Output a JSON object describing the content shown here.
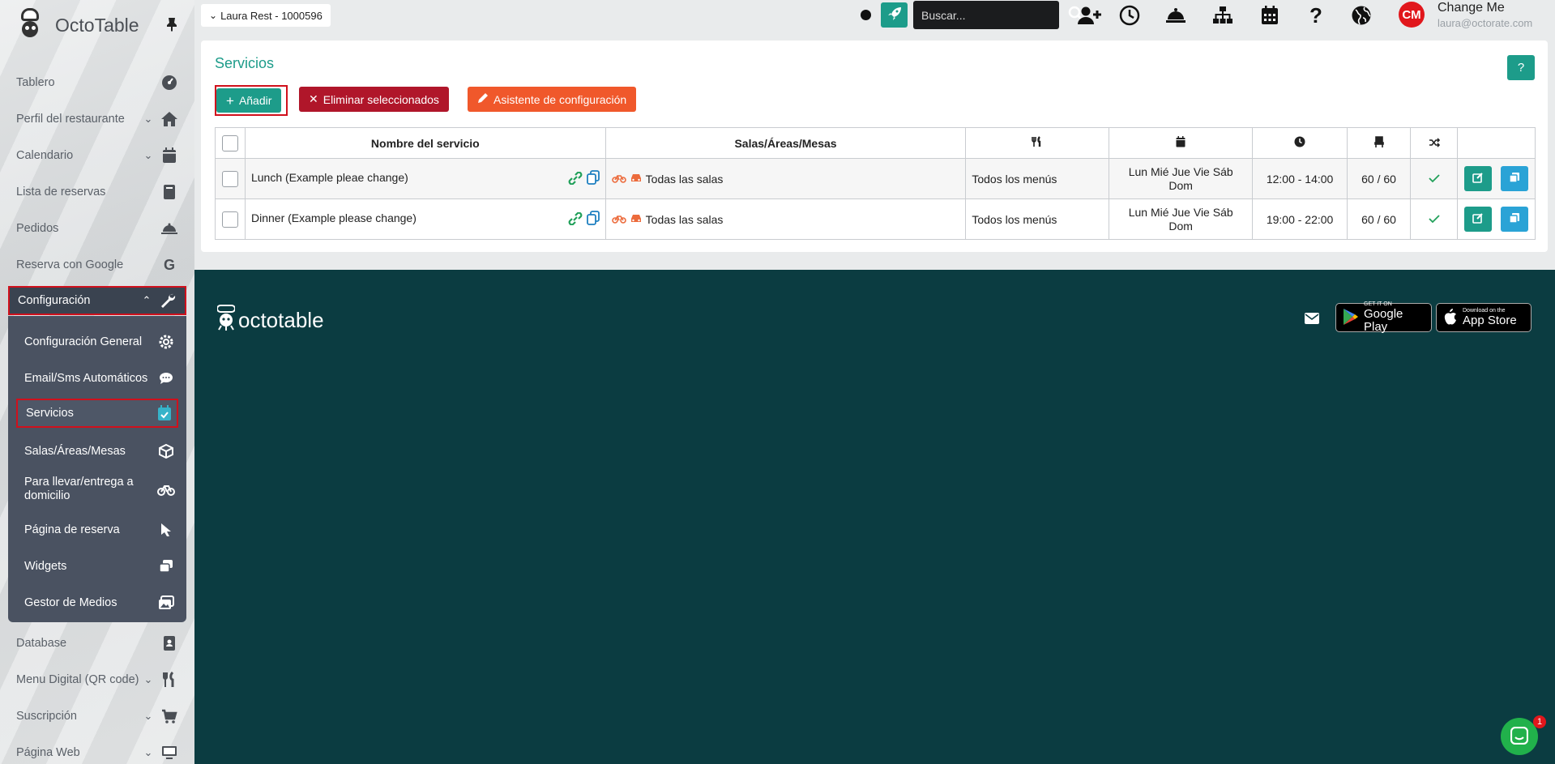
{
  "app": {
    "name": "OctoTable"
  },
  "sidebar": {
    "items": [
      {
        "label": "Tablero",
        "icon": "dashboard-icon"
      },
      {
        "label": "Perfil del restaurante",
        "icon": "home-icon",
        "expandable": true
      },
      {
        "label": "Calendario",
        "icon": "calendar-icon",
        "expandable": true
      },
      {
        "label": "Lista de reservas",
        "icon": "book-icon"
      },
      {
        "label": "Pedidos",
        "icon": "cloche-icon"
      },
      {
        "label": "Reserva con Google",
        "icon": "google-icon"
      },
      {
        "label": "Configuración",
        "icon": "wrench-icon",
        "expandable": true,
        "active": true
      },
      {
        "label": "Database",
        "icon": "contact-book-icon"
      },
      {
        "label": "Menu Digital (QR code)",
        "icon": "utensils-icon",
        "expandable": true
      },
      {
        "label": "Suscripción",
        "icon": "cart-icon",
        "expandable": true
      },
      {
        "label": "Página Web",
        "icon": "monitor-icon",
        "expandable": true
      }
    ],
    "submenu": [
      {
        "label": "Configuración General",
        "icon": "gear-icon"
      },
      {
        "label": "Email/Sms Automáticos",
        "icon": "chat-icon"
      },
      {
        "label": "Servicios",
        "icon": "calendar-check-icon",
        "active": true
      },
      {
        "label": "Salas/Áreas/Mesas",
        "icon": "cube-icon"
      },
      {
        "label": "Para llevar/entrega a domicilio",
        "icon": "bike-icon"
      },
      {
        "label": "Página de reserva",
        "icon": "cursor-icon"
      },
      {
        "label": "Widgets",
        "icon": "windows-icon"
      },
      {
        "label": "Gestor de Medios",
        "icon": "images-icon"
      }
    ]
  },
  "topbar": {
    "restaurant": "Laura Rest - 1000596",
    "search_placeholder": "Buscar...",
    "user": {
      "initials": "CM",
      "name": "Change Me",
      "email": "laura@octorate.com"
    }
  },
  "page": {
    "title": "Servicios",
    "help_label": "?",
    "buttons": {
      "add": "Añadir",
      "delete": "Eliminar seleccionados",
      "wizard": "Asistente de configuración"
    },
    "table": {
      "headers": {
        "name": "Nombre del servicio",
        "rooms": "Salas/Áreas/Mesas"
      },
      "rows": [
        {
          "name": "Lunch (Example pleae change)",
          "rooms": "Todas las salas",
          "menus": "Todos los menús",
          "days": "Lun Mié Jue Vie Sáb Dom",
          "hours": "12:00 - 14:00",
          "seats": "60 / 60"
        },
        {
          "name": "Dinner (Example please change)",
          "rooms": "Todas las salas",
          "menus": "Todos los menús",
          "days": "Lun Mié Jue Vie Sáb Dom",
          "hours": "19:00 - 22:00",
          "seats": "60 / 60"
        }
      ]
    }
  },
  "footer": {
    "logo_text": "octotable",
    "google_play": {
      "small": "GET IT ON",
      "big": "Google Play"
    },
    "app_store": {
      "small": "Download on the",
      "big": "App Store"
    }
  },
  "chat": {
    "badge": "1"
  },
  "colors": {
    "primary": "#1d9c8a",
    "danger": "#b0162a",
    "orange": "#f0582b",
    "footer": "#0b3c41",
    "highlight": "#d0101c"
  }
}
